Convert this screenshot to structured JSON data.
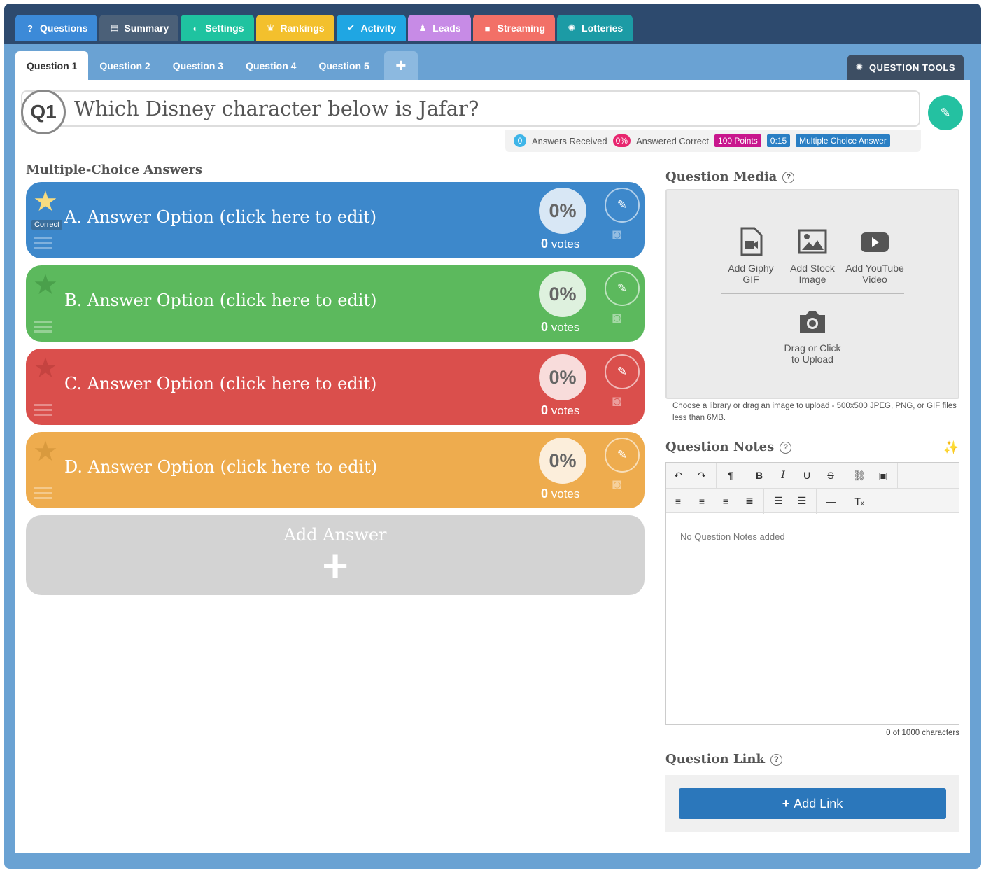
{
  "top_tabs": [
    {
      "label": "Questions",
      "icon": "?",
      "color": "#3c8ad8"
    },
    {
      "label": "Summary",
      "icon": "☰",
      "color": "#4b6078"
    },
    {
      "label": "Settings",
      "icon": "◐",
      "color": "#1fc3a0"
    },
    {
      "label": "Rankings",
      "icon": "🏆",
      "color": "#f3c02d"
    },
    {
      "label": "Activity",
      "icon": "✔",
      "color": "#1fa6e3"
    },
    {
      "label": "Leads",
      "icon": "👤",
      "color": "#c78be6"
    },
    {
      "label": "Streaming",
      "icon": "■",
      "color": "#f27067"
    },
    {
      "label": "Lotteries",
      "icon": "✺",
      "color": "#1c9ba5"
    }
  ],
  "question_tabs": [
    "Question 1",
    "Question 2",
    "Question 3",
    "Question 4",
    "Question 5"
  ],
  "question_tools_label": "QUESTION TOOLS",
  "question": {
    "badge": "Q1",
    "text": "Which Disney character below is Jafar?"
  },
  "stats": {
    "answers_received_count": "0",
    "answers_received_label": "Answers Received",
    "answered_correct_pct": "0%",
    "answered_correct_label": "Answered Correct",
    "points": "100 Points",
    "timer": "0:15",
    "type": "Multiple Choice Answer"
  },
  "answers_heading": "Multiple-Choice Answers",
  "answers": [
    {
      "label": "A. Answer Option (click here to edit)",
      "percent": "0%",
      "votes": "0",
      "votes_label": "votes",
      "correct": true,
      "correct_label": "Correct",
      "color": "#3d88cb"
    },
    {
      "label": "B. Answer Option (click here to edit)",
      "percent": "0%",
      "votes": "0",
      "votes_label": "votes",
      "correct": false,
      "color": "#5cb95d"
    },
    {
      "label": "C. Answer Option (click here to edit)",
      "percent": "0%",
      "votes": "0",
      "votes_label": "votes",
      "correct": false,
      "color": "#da4f4c"
    },
    {
      "label": "D. Answer Option (click here to edit)",
      "percent": "0%",
      "votes": "0",
      "votes_label": "votes",
      "correct": false,
      "color": "#eeac4e"
    }
  ],
  "add_answer_label": "Add Answer",
  "media": {
    "heading": "Question Media",
    "help": "?",
    "giphy": "Add Giphy GIF",
    "stock": "Add Stock Image",
    "youtube": "Add YouTube Video",
    "upload": "Drag or Click to Upload",
    "hint": "Choose a library or drag an image to upload - 500x500 JPEG, PNG, or GIF files less than 6MB."
  },
  "notes": {
    "heading": "Question Notes",
    "help": "?",
    "placeholder": "No Question Notes added",
    "char_count": "0 of 1000 characters"
  },
  "link": {
    "heading": "Question Link",
    "help": "?",
    "button": "Add Link"
  }
}
